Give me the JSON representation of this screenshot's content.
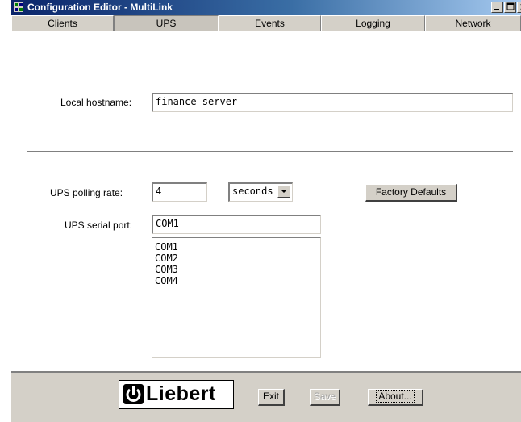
{
  "window": {
    "title": "Configuration Editor - MultiLink"
  },
  "tabs": [
    {
      "label": "Clients",
      "active": false
    },
    {
      "label": "UPS",
      "active": true
    },
    {
      "label": "Events",
      "active": false
    },
    {
      "label": "Logging",
      "active": false
    },
    {
      "label": "Network",
      "active": false
    }
  ],
  "form": {
    "local_hostname_label": "Local hostname:",
    "local_hostname_value": "finance-server",
    "polling_rate_label": "UPS polling rate:",
    "polling_rate_value": "4",
    "polling_unit": "seconds",
    "factory_defaults_label": "Factory Defaults",
    "serial_port_label": "UPS serial port:",
    "serial_port_value": "COM1",
    "serial_port_options": [
      "COM1",
      "COM2",
      "COM3",
      "COM4"
    ]
  },
  "footer": {
    "logo_text": "Liebert",
    "exit_label": "Exit",
    "save_label": "Save",
    "save_enabled": false,
    "about_label": "About..."
  },
  "icons": {
    "app": "app-icon",
    "minimize": "minimize-icon",
    "maximize": "maximize-icon",
    "close": "close-icon",
    "dropdown": "chevron-down-icon",
    "logo": "liebert-logo-icon"
  },
  "colors": {
    "titlebar_start": "#0a246a",
    "titlebar_end": "#a6caf0",
    "face": "#d4d0c8"
  }
}
